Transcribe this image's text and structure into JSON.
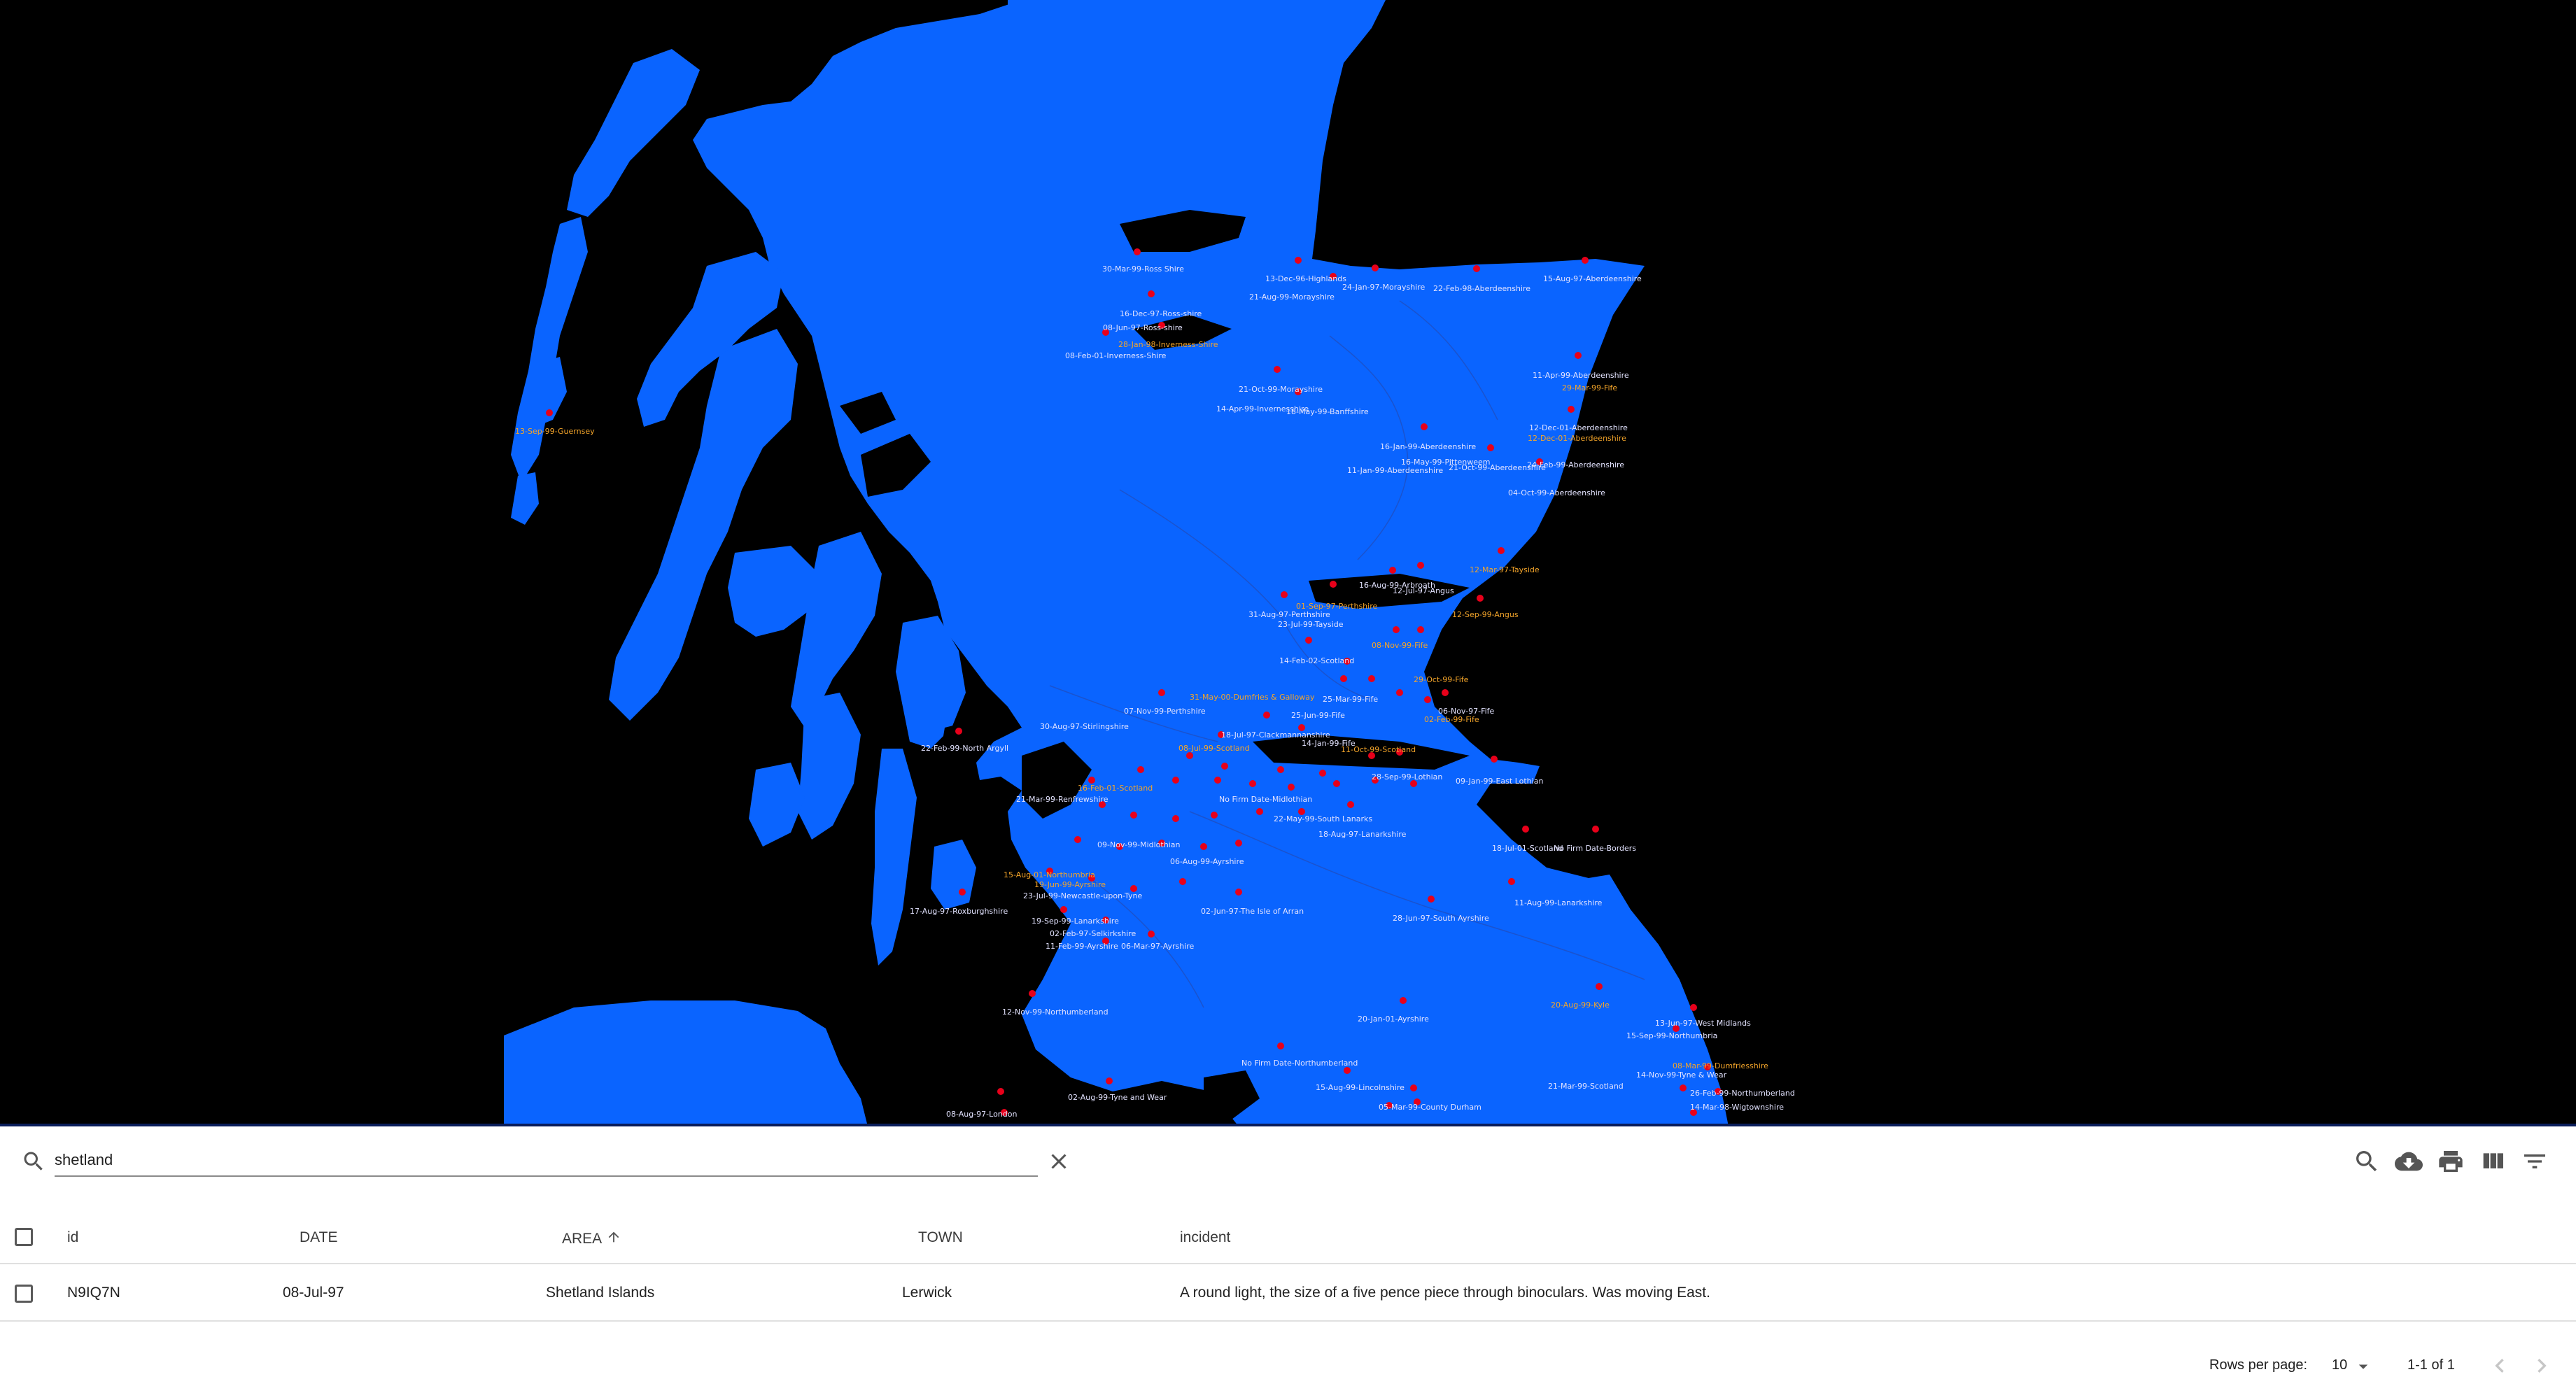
{
  "map": {
    "labels": [
      {
        "text": "30-Mar-99-Ross Shire",
        "c": "w"
      },
      {
        "text": "13-Dec-96-Highlands",
        "c": "w"
      },
      {
        "text": "24-Jan-97-Morayshire",
        "c": "w"
      },
      {
        "text": "21-Aug-99-Morayshire",
        "c": "w"
      },
      {
        "text": "22-Feb-98-Aberdeenshire",
        "c": "w"
      },
      {
        "text": "15-Aug-97-Aberdeenshire",
        "c": "w"
      },
      {
        "text": "16-Dec-97-Ross-shire",
        "c": "w"
      },
      {
        "text": "08-Jun-97-Ross-shire",
        "c": "w"
      },
      {
        "text": "28-Jan-98-Inverness-Shire",
        "c": "o"
      },
      {
        "text": "08-Feb-01-Inverness-Shire",
        "c": "w"
      },
      {
        "text": "21-Oct-99-Morayshire",
        "c": "w"
      },
      {
        "text": "14-Apr-99-Invernesshire",
        "c": "w"
      },
      {
        "text": "18-May-99-Banffshire",
        "c": "w"
      },
      {
        "text": "11-Apr-99-Aberdeenshire",
        "c": "w"
      },
      {
        "text": "29-Mar-99-Fife",
        "c": "o"
      },
      {
        "text": "12-Dec-01-Aberdeenshire",
        "c": "w"
      },
      {
        "text": "12-Dec-01-Aberdeenshire",
        "c": "o"
      },
      {
        "text": "13-Sep-99-Guernsey",
        "c": "o"
      },
      {
        "text": "16-Jan-99-Aberdeenshire",
        "c": "w"
      },
      {
        "text": "16-May-99-Pittenweem",
        "c": "w"
      },
      {
        "text": "11-Jan-99-Aberdeenshire",
        "c": "w"
      },
      {
        "text": "21-Oct-99-Aberdeenshire",
        "c": "w"
      },
      {
        "text": "24-Feb-99-Aberdeenshire",
        "c": "w"
      },
      {
        "text": "04-Oct-99-Aberdeenshire",
        "c": "w"
      },
      {
        "text": "12-Mar-97-Tayside",
        "c": "o"
      },
      {
        "text": "16-Aug-99-Arbroath",
        "c": "w"
      },
      {
        "text": "12-Jul-97-Angus",
        "c": "w"
      },
      {
        "text": "01-Sep-97-Perthshire",
        "c": "o"
      },
      {
        "text": "31-Aug-97-Perthshire",
        "c": "w"
      },
      {
        "text": "12-Sep-99-Angus",
        "c": "o"
      },
      {
        "text": "23-Jul-99-Tayside",
        "c": "w"
      },
      {
        "text": "08-Nov-99-Fife",
        "c": "o"
      },
      {
        "text": "14-Feb-02-Scotland",
        "c": "w"
      },
      {
        "text": "29-Oct-99-Fife",
        "c": "o"
      },
      {
        "text": "25-Mar-99-Fife",
        "c": "w"
      },
      {
        "text": "06-Nov-97-Fife",
        "c": "w"
      },
      {
        "text": "02-Feb-99-Fife",
        "c": "o"
      },
      {
        "text": "07-Nov-99-Perthshire",
        "c": "w"
      },
      {
        "text": "30-Aug-97-Stirlingshire",
        "c": "w"
      },
      {
        "text": "25-Jun-99-Fife",
        "c": "w"
      },
      {
        "text": "18-Jul-97-Clackmannanshire",
        "c": "w"
      },
      {
        "text": "22-Feb-99-North Argyll",
        "c": "w"
      },
      {
        "text": "08-Jul-99-Scotland",
        "c": "o"
      },
      {
        "text": "14-Jan-99-Fife",
        "c": "w"
      },
      {
        "text": "11-Oct-99-Scotland",
        "c": "o"
      },
      {
        "text": "28-Sep-99-Lothian",
        "c": "w"
      },
      {
        "text": "09-Jan-99-East Lothian",
        "c": "w"
      },
      {
        "text": "21-Mar-99-Renfrewshire",
        "c": "w"
      },
      {
        "text": "16-Feb-01-Scotland",
        "c": "o"
      },
      {
        "text": "22-May-99-South Lanarks",
        "c": "w"
      },
      {
        "text": "No Firm Date-Midlothian",
        "c": "w"
      },
      {
        "text": "18-Aug-97-Lanarkshire",
        "c": "w"
      },
      {
        "text": "09-Nov-99-Midlothian",
        "c": "w"
      },
      {
        "text": "18-Jul-01-Scotland",
        "c": "w"
      },
      {
        "text": "No Firm Date-Borders",
        "c": "w"
      },
      {
        "text": "15-Aug-01-Northumbria",
        "c": "o"
      },
      {
        "text": "19-Jun-99-Ayrshire",
        "c": "o"
      },
      {
        "text": "23-Jul-99-Newcastle-upon-Tyne",
        "c": "w"
      },
      {
        "text": "06-Aug-99-Ayrshire",
        "c": "w"
      },
      {
        "text": "11-Aug-99-Lanarkshire",
        "c": "w"
      },
      {
        "text": "17-Aug-97-Roxburghshire",
        "c": "w"
      },
      {
        "text": "02-Jun-97-The Isle of Arran",
        "c": "w"
      },
      {
        "text": "19-Sep-99-Lanarkshire",
        "c": "w"
      },
      {
        "text": "28-Jun-97-South Ayrshire",
        "c": "w"
      },
      {
        "text": "02-Feb-97-Selkirkshire",
        "c": "w"
      },
      {
        "text": "11-Feb-99-Ayrshire",
        "c": "w"
      },
      {
        "text": "06-Mar-97-Ayrshire",
        "c": "w"
      },
      {
        "text": "20-Aug-99-Kyle",
        "c": "o"
      },
      {
        "text": "12-Nov-99-Northumberland",
        "c": "w"
      },
      {
        "text": "20-Jan-01-Ayrshire",
        "c": "w"
      },
      {
        "text": "13-Jun-97-West Midlands",
        "c": "w"
      },
      {
        "text": "15-Sep-99-Northumbria",
        "c": "w"
      },
      {
        "text": "No Firm Date-Northumberland",
        "c": "w"
      },
      {
        "text": "08-Mar-99-Dumfriesshire",
        "c": "o"
      },
      {
        "text": "14-Nov-99-Tyne & Wear",
        "c": "w"
      },
      {
        "text": "15-Aug-99-Lincolnshire",
        "c": "w"
      },
      {
        "text": "21-Mar-99-Scotland",
        "c": "w"
      },
      {
        "text": "26-Feb-99-Northumberland",
        "c": "w"
      },
      {
        "text": "02-Aug-99-Tyne and Wear",
        "c": "w"
      },
      {
        "text": "14-Mar-98-Wigtownshire",
        "c": "w"
      },
      {
        "text": "05-Mar-99-County Durham",
        "c": "w"
      },
      {
        "text": "08-Aug-97-London",
        "c": "w"
      },
      {
        "text": "31-May-00-Dumfries & Galloway",
        "c": "o"
      }
    ]
  },
  "search": {
    "value": "shetland",
    "placeholder": "Search"
  },
  "toolbar": {
    "icons": [
      "search-icon",
      "cloud-download-icon",
      "print-icon",
      "view-columns-icon",
      "filter-list-icon"
    ]
  },
  "table": {
    "columns": [
      {
        "key": "id",
        "label": "id"
      },
      {
        "key": "date",
        "label": "DATE"
      },
      {
        "key": "area",
        "label": "AREA",
        "sort": "ascending"
      },
      {
        "key": "town",
        "label": "TOWN"
      },
      {
        "key": "incident",
        "label": "incident"
      }
    ],
    "rows": [
      {
        "id": "N9IQ7N",
        "date": "08-Jul-97",
        "area": "Shetland Islands",
        "town": "Lerwick",
        "incident": "A round light, the size of a five pence piece through binoculars. Was moving East."
      }
    ]
  },
  "footer": {
    "rows_per_page_label": "Rows per page:",
    "rows_per_page_value": "10",
    "range_label": "1-1 of 1"
  },
  "colors": {
    "land": "#0a64ff",
    "sea": "#000000",
    "marker": "#e8001a",
    "label_white": "#e3e3ff",
    "label_orange": "#f4a52a"
  }
}
